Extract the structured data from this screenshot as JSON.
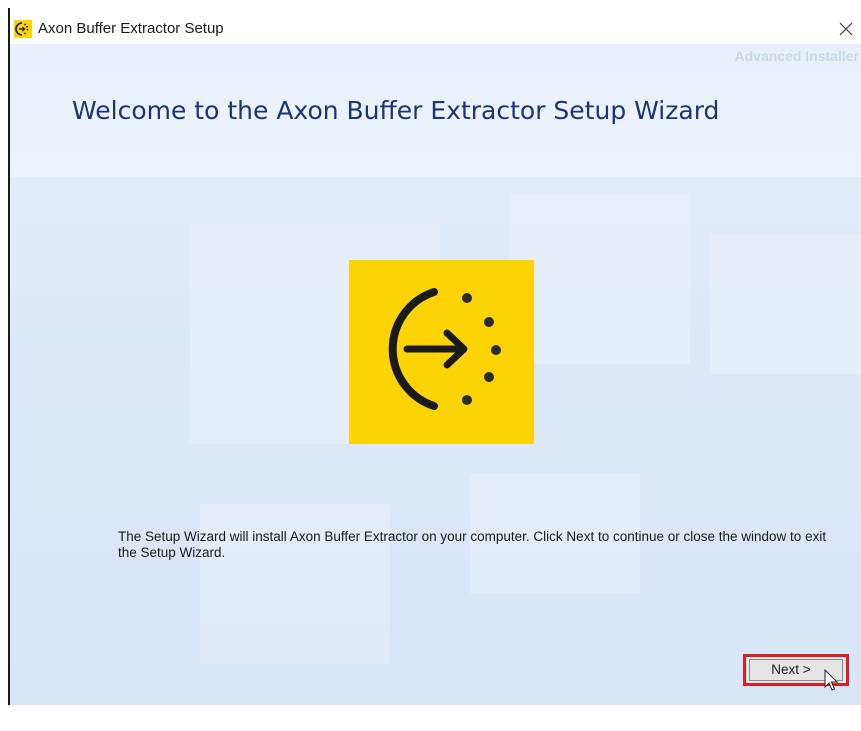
{
  "window": {
    "title": "Axon Buffer Extractor Setup",
    "close_icon": "close-icon",
    "app_icon": "axon-logo-icon"
  },
  "header": {
    "brand": "Advanced Installer",
    "welcome_title": "Welcome to the Axon Buffer Extractor Setup Wizard"
  },
  "main": {
    "logo": "axon-logo-icon",
    "logo_color": "#FCD406",
    "description": "The Setup Wizard will install Axon Buffer Extractor on your computer. Click Next to continue or close the window to exit the Setup Wizard."
  },
  "footer": {
    "next_label": "Next >",
    "highlight_color": "#D91E25"
  }
}
